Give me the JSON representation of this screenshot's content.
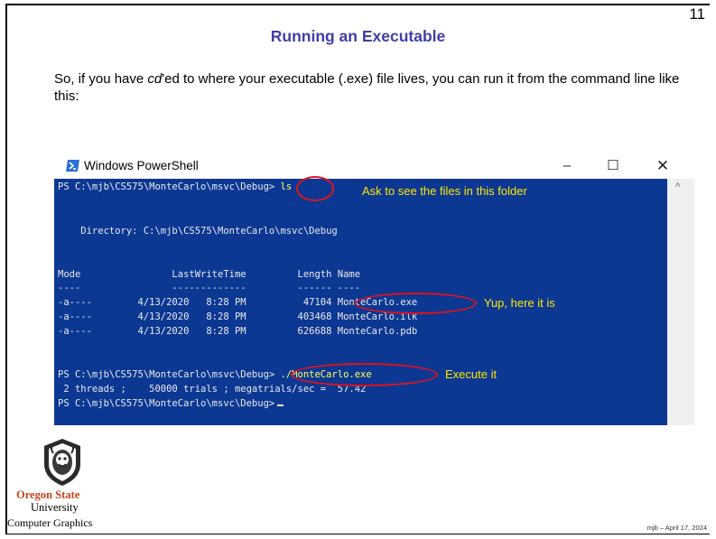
{
  "slide": {
    "number": "11",
    "title": "Running an Executable",
    "body_before": "So, if you have ",
    "body_em": "cd",
    "body_after": "'ed to where your executable (.exe) file lives, you can run it from the command line like this:",
    "footer_date": "mjb – April 17, 2024"
  },
  "window": {
    "title": "Windows PowerShell",
    "minimize": "–",
    "maximize": "☐",
    "close": "✕",
    "scroll_up": "^"
  },
  "console": {
    "prompt1": "PS C:\\mjb\\CS575\\MonteCarlo\\msvc\\Debug>",
    "cmd1": " ls",
    "directory": "    Directory: C:\\mjb\\CS575\\MonteCarlo\\msvc\\Debug",
    "header": "Mode                LastWriteTime         Length Name",
    "separator": "----                -------------         ------ ----",
    "rows": [
      "-a----        4/13/2020   8:28 PM          47104 MonteCarlo.exe",
      "-a----        4/13/2020   8:28 PM         403468 MonteCarlo.ilk",
      "-a----        4/13/2020   8:28 PM         626688 MonteCarlo.pdb"
    ],
    "prompt2": "PS C:\\mjb\\CS575\\MonteCarlo\\msvc\\Debug>",
    "cmd2": " ./MonteCarlo.exe",
    "output": " 2 threads ;    50000 trials ; megatrials/sec =  57.42",
    "prompt3": "PS C:\\mjb\\CS575\\MonteCarlo\\msvc\\Debug>"
  },
  "annotations": {
    "ls": "Ask to see the files in this folder",
    "exe": "Yup, here it is",
    "execute": "Execute it"
  },
  "logo": {
    "line1": "Oregon State",
    "line2": "University",
    "line3": "Computer Graphics",
    "colors": {
      "brand": "#c5441c"
    }
  },
  "colors": {
    "title": "#3f3fa6",
    "console_bg": "#0c3893",
    "annotation": "#ffe800",
    "circle": "#e0131a"
  }
}
